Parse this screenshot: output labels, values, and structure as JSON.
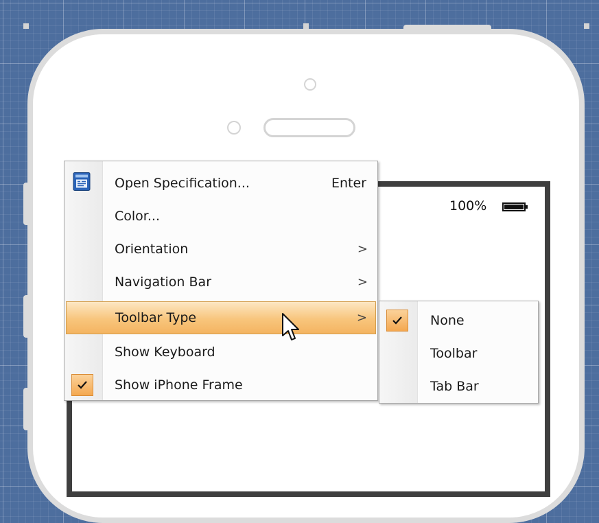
{
  "status_bar": {
    "battery_percent": "100%"
  },
  "context_menu": {
    "items": [
      {
        "label": "Open Specification...",
        "shortcut": "Enter",
        "icon": "specification-icon"
      },
      {
        "label": "Color..."
      },
      {
        "label": "Orientation",
        "submenu": true
      },
      {
        "label": "Navigation Bar",
        "submenu": true
      },
      {
        "label": "Toolbar Type",
        "submenu": true,
        "highlighted": true
      },
      {
        "label": "Show Keyboard"
      },
      {
        "label": "Show iPhone Frame",
        "checked": true
      }
    ],
    "arrow_glyph": ">",
    "check_glyph": "✓"
  },
  "toolbar_type_submenu": {
    "items": [
      {
        "label": "None",
        "checked": true
      },
      {
        "label": "Toolbar"
      },
      {
        "label": "Tab Bar"
      }
    ]
  },
  "colors": {
    "canvas_grid": "#4d6e9e",
    "menu_highlight": "#f8c57c",
    "check_accent": "#f4a850",
    "phone_frame": "#dcdcdc",
    "screen_border": "#3f3f3f"
  }
}
